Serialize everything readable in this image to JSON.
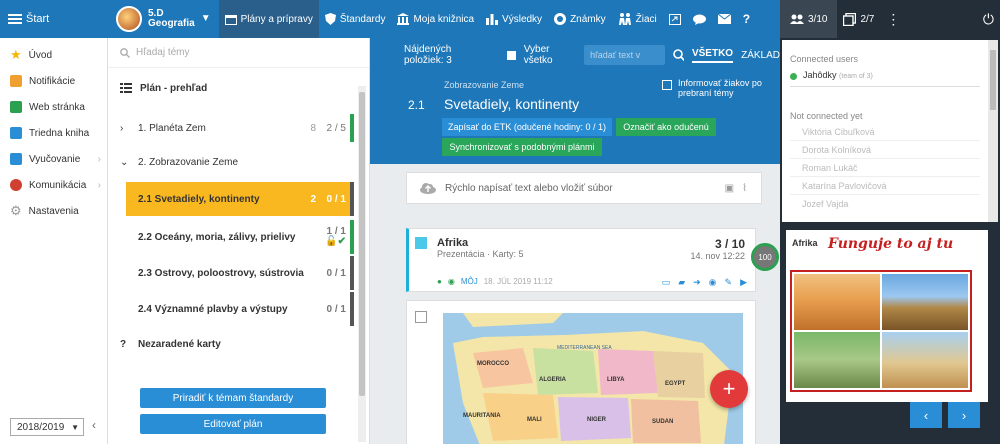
{
  "topbar": {
    "menu_label": "Štart",
    "class_name": "5.D",
    "class_subject": "Geografia",
    "tabs": [
      {
        "label": "Plány a prípravy",
        "icon": "calendar-icon"
      },
      {
        "label": "Štandardy",
        "icon": "shield-icon"
      },
      {
        "label": "Moja knižnica",
        "icon": "library-icon"
      },
      {
        "label": "Výsledky",
        "icon": "bar-chart-icon"
      },
      {
        "label": "Známky",
        "icon": "grade-icon"
      },
      {
        "label": "Žiaci",
        "icon": "students-icon"
      }
    ],
    "users_count": "3/10",
    "windows_count": "2/7"
  },
  "sidebar": {
    "items": [
      {
        "label": "Úvod",
        "color": "#f5b800"
      },
      {
        "label": "Notifikácie",
        "color": "#f0a030"
      },
      {
        "label": "Web stránka",
        "color": "#2aa050"
      },
      {
        "label": "Triedna kniha",
        "color": "#2a8ed6"
      },
      {
        "label": "Vyučovanie",
        "color": "#2a8ed6"
      },
      {
        "label": "Komunikácia",
        "color": "#d04030"
      },
      {
        "label": "Nastavenia",
        "color": "#999999"
      }
    ],
    "year": "2018/2019"
  },
  "plan": {
    "search_placeholder": "Hľadaj témy",
    "title": "Plán - prehľad",
    "rows": [
      {
        "label": "1. Planéta Zem",
        "count": "8",
        "score": "2 / 5",
        "prefix": "›"
      },
      {
        "label": "2. Zobrazovanie Zeme",
        "count": "",
        "score": "",
        "prefix": "⌄"
      },
      {
        "label": "2.1  Svetadiely, kontinenty",
        "count": "2",
        "score": "0 / 1",
        "prefix": ""
      },
      {
        "label": "2.2  Oceány, moria, zálivy, prielivy",
        "count": "",
        "score": "1 / 1",
        "prefix": ""
      },
      {
        "label": "2.3  Ostrovy, poloostrovy, sústrovia",
        "count": "",
        "score": "0 / 1",
        "prefix": ""
      },
      {
        "label": "2.4  Významné plavby a výstupy",
        "count": "",
        "score": "0 / 1",
        "prefix": ""
      },
      {
        "label": "Nezaradené karty",
        "count": "",
        "score": "",
        "prefix": "?"
      }
    ],
    "btn_assign": "Priradiť k témam štandardy",
    "btn_edit": "Editovať plán"
  },
  "main": {
    "found_label": "Nájdených položiek: 3",
    "select_all": "Vyber všetko",
    "search_placeholder": "hľadať text v",
    "tab_all": "VŠETKO",
    "tab_basic": "ZÁKLAD",
    "topic_parent": "Zobrazovanie Zeme",
    "topic_num": "2.1",
    "topic_title": "Svetadiely, kontinenty",
    "inform_label": "Informovať žiakov po prebraní témy",
    "btn_etk": "Zapísať do ETK (odučené hodiny: 0 / 1)",
    "btn_mark": "Označiť ako odučenú",
    "btn_sync": "Synchronizovať s podobnými plánmi",
    "upload_text": "Rýchlo napísať text alebo vložiť súbor",
    "card": {
      "title": "Afrika",
      "subtitle": "Prezentácia · Karty: 5",
      "views": "3 / 10",
      "date": "14. nov 12:22",
      "meta_owner": "MÔJ",
      "meta_date": "18. JÚL 2019 11:12",
      "progress": "100"
    },
    "map_labels": [
      "MOROCCO",
      "ALGERIA",
      "LIBYA",
      "EGYPT",
      "MALI",
      "NIGER",
      "SUDAN",
      "MAURITANIA",
      "MEDITERRANEAN SEA"
    ]
  },
  "right": {
    "connected_label": "Connected users",
    "connected_user": "Jahôdky",
    "connected_user_meta": "(team of 3)",
    "not_connected_label": "Not connected yet",
    "not_connected": [
      "Viktória Cibuľková",
      "Dorota Kolníková",
      "Roman Lukáč",
      "Katarína Pavlovičová",
      "Jozef Vajda"
    ],
    "board_title": "Afrika",
    "board_note": "Funguje to aj tu"
  }
}
